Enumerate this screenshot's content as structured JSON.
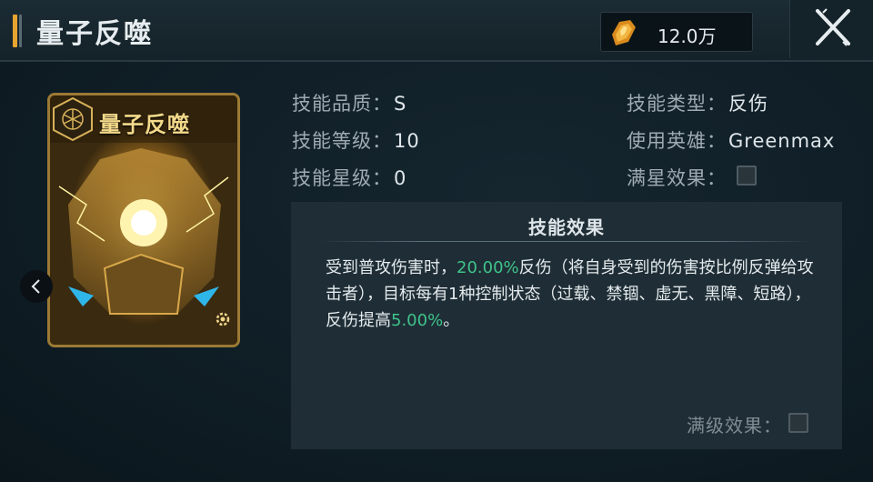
{
  "header": {
    "title": "量子反噬",
    "currency": {
      "icon": "crystal-icon",
      "value": "12.0万",
      "color": "#e8a430"
    },
    "close": {
      "icon": "close-icon"
    }
  },
  "card": {
    "name": "量子反噬",
    "badge_icon": "hexagon-emblem-icon",
    "corner_icon": "gear-icon",
    "accent_color": "#9b7a35"
  },
  "nav": {
    "prev_icon": "chevron-left-icon"
  },
  "info": {
    "quality_label": "技能品质：",
    "quality_value": "S",
    "level_label": "技能等级：",
    "level_value": "10",
    "star_label": "技能星级：",
    "star_value": "0",
    "type_label": "技能类型：",
    "type_value": "反伤",
    "hero_label": "使用英雄：",
    "hero_value": "Greenmax",
    "max_star_label": "满星效果：",
    "max_star_checked": false
  },
  "effect": {
    "title": "技能效果",
    "part1": "受到普攻伤害时，",
    "value1": "20.00%",
    "part2": "反伤（将自身受到的伤害按比例反弹给攻击者），目标每有1种控制状态（过载、禁锢、虚无、黑障、短路），反伤提高",
    "value2": "5.00%",
    "part3": "。",
    "highlight_color": "#3fc38a",
    "max_level_label": "满级效果：",
    "max_level_checked": false
  }
}
